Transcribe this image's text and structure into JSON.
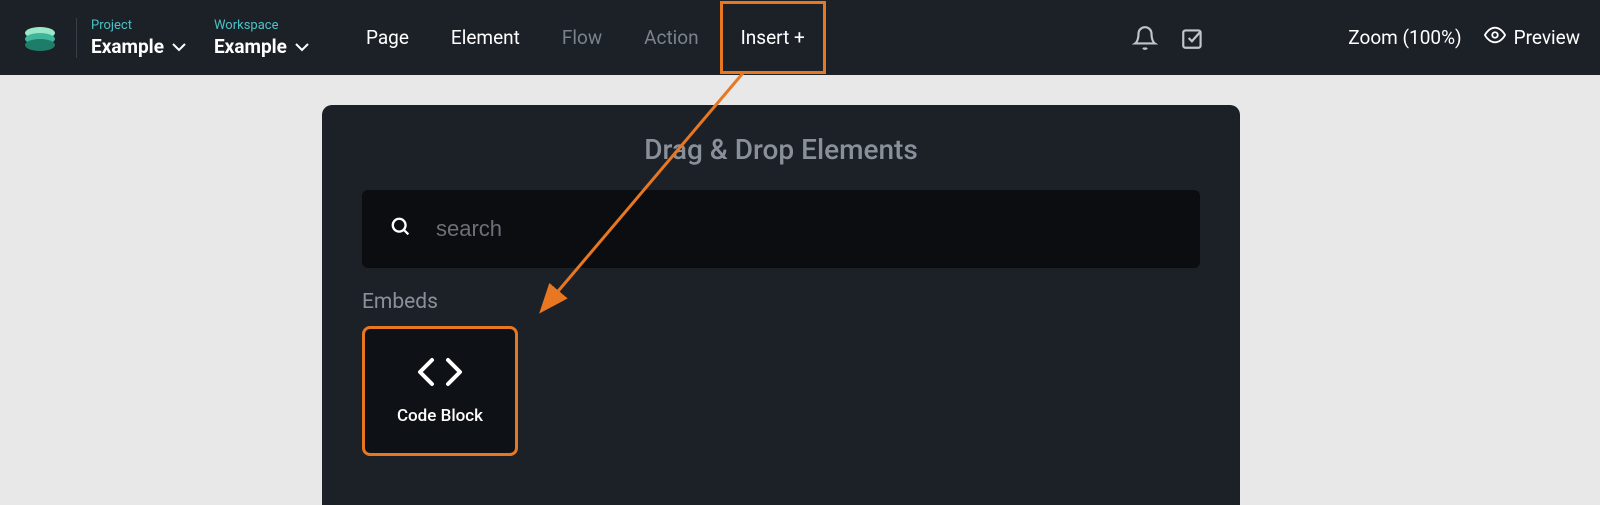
{
  "project": {
    "label": "Project",
    "value": "Example"
  },
  "workspace": {
    "label": "Workspace",
    "value": "Example"
  },
  "nav": {
    "page": "Page",
    "element": "Element",
    "flow": "Flow",
    "action": "Action",
    "insert": "Insert +"
  },
  "zoom": "Zoom (100%)",
  "preview": "Preview",
  "panel": {
    "title": "Drag & Drop Elements",
    "search_placeholder": "search",
    "section": "Embeds",
    "tile": "Code Block"
  },
  "colors": {
    "highlight": "#e87722",
    "accent": "#4cc2c5"
  }
}
